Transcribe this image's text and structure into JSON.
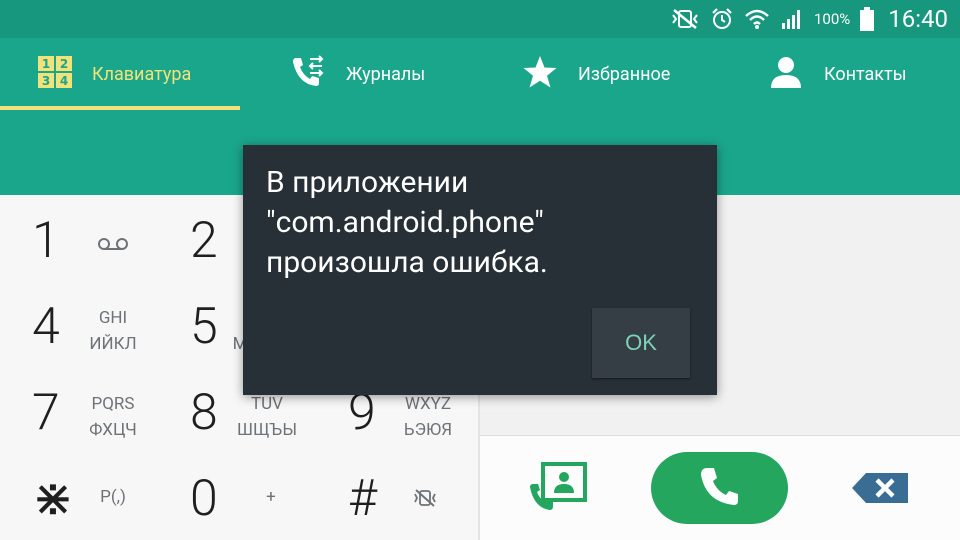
{
  "status_bar": {
    "battery": "100%",
    "time": "16:40"
  },
  "tabs": [
    {
      "label": "Клавиатура",
      "icon": "keypad-grid-icon",
      "active": true
    },
    {
      "label": "Журналы",
      "icon": "call-log-icon",
      "active": false
    },
    {
      "label": "Избранное",
      "icon": "star-icon",
      "active": false
    },
    {
      "label": "Контакты",
      "icon": "person-icon",
      "active": false
    }
  ],
  "keypad_icon_digits": [
    "1",
    "2",
    "3",
    "4"
  ],
  "keys": [
    {
      "digit": "1",
      "sub1": "",
      "sub2": "",
      "icon": "voicemail-icon"
    },
    {
      "digit": "2",
      "sub1": "",
      "sub2": ""
    },
    {
      "digit": "4",
      "sub1": "GHI",
      "sub2": "ИЙКЛ"
    },
    {
      "digit": "5",
      "sub1": "",
      "sub2": "М"
    },
    {
      "digit": "7",
      "sub1": "PQRS",
      "sub2": "ФХЦЧ"
    },
    {
      "digit": "8",
      "sub1": "TUV",
      "sub2": "ШЩЪЫ"
    },
    {
      "digit": "9",
      "sub1": "WXYZ",
      "sub2": "ЬЭЮЯ"
    },
    {
      "digit": "⋇",
      "sub_single": "P(,)"
    },
    {
      "digit": "0",
      "sub_single": "+"
    },
    {
      "digit": "#",
      "icon": "vibrate-mute-icon"
    }
  ],
  "dialog": {
    "message": "В приложении \"com.android.phone\" произошла ошибка.",
    "ok_label": "OK"
  },
  "colors": {
    "status_bar": "#18977f",
    "header": "#1aa68b",
    "active_tab": "#f3e27a",
    "call_button": "#24a65e",
    "dialog_bg": "#273036",
    "dialog_accent": "#7dd1b8",
    "backspace": "#3a6d93"
  }
}
